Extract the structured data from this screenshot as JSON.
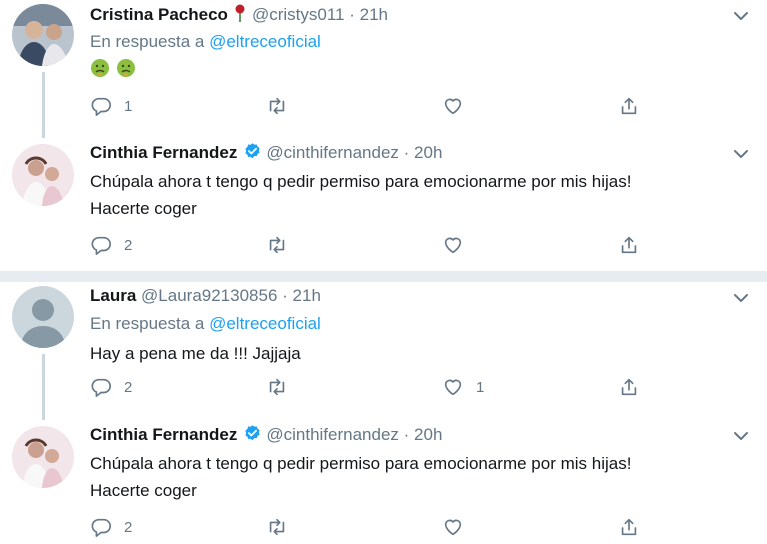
{
  "tweets": [
    {
      "name": "Cristina Pacheco",
      "handle": "@cristys011",
      "time": "21h",
      "reply_prefix": "En respuesta a",
      "reply_to": "@eltreceoficial",
      "emojis": [
        "nauseated-face",
        "nauseated-face"
      ],
      "actions": {
        "replies": "1",
        "retweets": "",
        "likes": ""
      }
    },
    {
      "name": "Cinthia Fernandez",
      "handle": "@cinthifernandez",
      "time": "20h",
      "verified": true,
      "text_line1": "Chúpala ahora t tengo q pedir permiso para emocionarme por mis hijas!",
      "text_line2": "Hacerte coger",
      "actions": {
        "replies": "2",
        "retweets": "",
        "likes": ""
      }
    },
    {
      "name": "Laura",
      "handle": "@Laura92130856",
      "time": "21h",
      "reply_prefix": "En respuesta a",
      "reply_to": "@eltreceoficial",
      "text": "Hay a pena me da !!! Jajjaja",
      "actions": {
        "replies": "2",
        "retweets": "",
        "likes": "1"
      }
    },
    {
      "name": "Cinthia Fernandez",
      "handle": "@cinthifernandez",
      "time": "20h",
      "verified": true,
      "text_line1": "Chúpala ahora t tengo q pedir permiso para emocionarme por mis hijas!",
      "text_line2": "Hacerte coger",
      "actions": {
        "replies": "2",
        "retweets": "",
        "likes": ""
      }
    }
  ],
  "colors": {
    "link": "#1da1f2",
    "muted": "#657786",
    "verified": "#1da1f2",
    "divider": "#e6ecf0"
  },
  "icons": [
    "reply-icon",
    "retweet-icon",
    "like-icon",
    "share-icon",
    "chevron-down-icon",
    "verified-badge-icon",
    "rose-icon"
  ]
}
